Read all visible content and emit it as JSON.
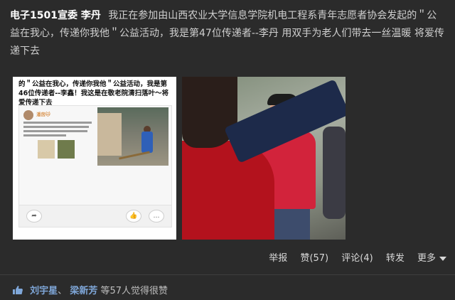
{
  "post": {
    "author": "电子1501宣委 李丹",
    "text": "我正在参加由山西农业大学信息学院机电工程系青年志愿者协会发起的＂公益在我心，传递你我他＂公益活动，我是第47位传递者--李丹 用双手为老人们带去一丝温暖 将爱传递下去"
  },
  "image_left": {
    "caption": "的＂公益在我心，传递你我他＂公益活动，我是第46位传递者--李鑫！我这是在敬老院清扫落叶～将爱传递下去",
    "inner_name": "潘茵🐱"
  },
  "actions": {
    "report": "举报",
    "like": "赞(57)",
    "comment": "评论(4)",
    "forward": "转发",
    "more": "更多"
  },
  "likes": {
    "name1": "刘宇星",
    "sep1": "、",
    "name2": "梁新芳",
    "suffix": "等57人觉得很赞"
  },
  "colors": {
    "background": "#2b2b2b",
    "link": "#7fa7d9"
  }
}
